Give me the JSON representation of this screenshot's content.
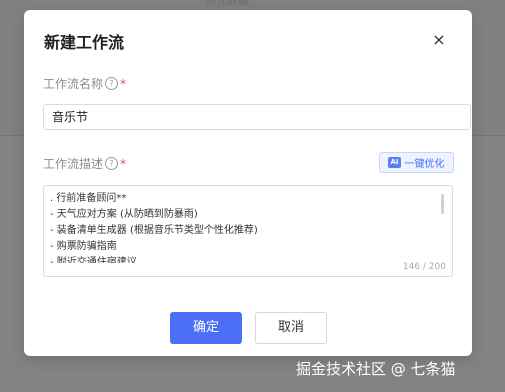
{
  "background": {
    "faded_text": "添元数据"
  },
  "dialog": {
    "title": "新建工作流",
    "close_symbol": "×",
    "name_field": {
      "label": "工作流名称",
      "help_symbol": "?",
      "required_mark": "*",
      "value": "音乐节"
    },
    "desc_field": {
      "label": "工作流描述",
      "help_symbol": "?",
      "required_mark": "*",
      "optimize_button": {
        "badge": "AI",
        "label": "一键优化"
      },
      "lines": [
        ". 行前准备顾问**",
        "- 天气应对方案 (从防晒到防暴雨)",
        "- 装备清单生成器 (根据音乐节类型个性化推荐)",
        "- 购票防骗指南",
        "- 附近交通住宿建议"
      ],
      "counter": "146 / 200"
    },
    "confirm_label": "确定",
    "cancel_label": "取消"
  },
  "watermark": "掘金技术社区 @ 七条猫"
}
